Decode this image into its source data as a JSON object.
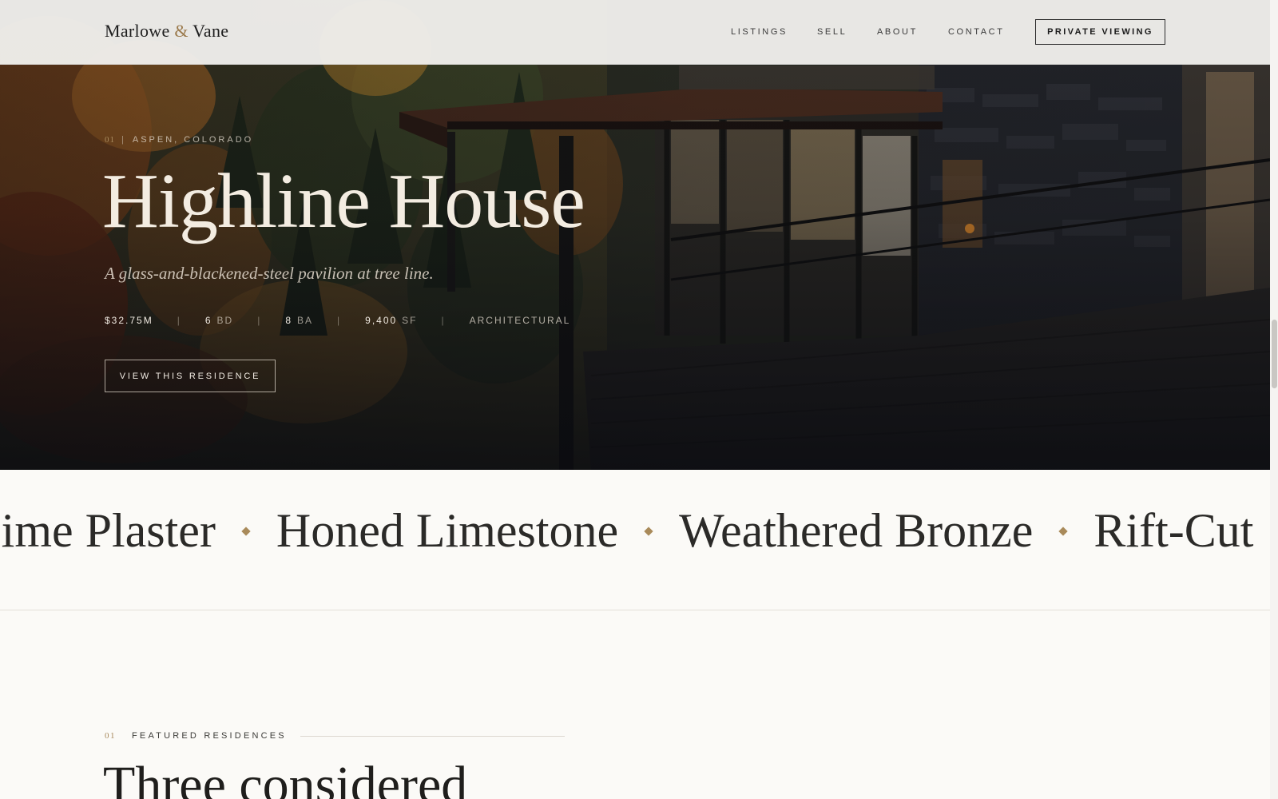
{
  "header": {
    "logo_left": "Marlowe",
    "logo_amp": "&",
    "logo_right": "Vane",
    "nav": [
      "LISTINGS",
      "SELL",
      "ABOUT",
      "CONTACT"
    ],
    "cta": "PRIVATE VIEWING"
  },
  "hero": {
    "index": "01",
    "location": "ASPEN, COLORADO",
    "title": "Highline House",
    "subtitle": "A glass-and-blackened-steel pavilion at tree line.",
    "price": "$32.75M",
    "beds_value": "6",
    "beds_unit": "BD",
    "baths_value": "8",
    "baths_unit": "BA",
    "area_value": "9,400",
    "area_unit": "SF",
    "style": "ARCHITECTURAL",
    "button": "VIEW THIS RESIDENCE"
  },
  "marquee": {
    "items": [
      "Lime Plaster",
      "Honed Limestone",
      "Weathered Bronze",
      "Rift-Cut"
    ]
  },
  "featured": {
    "index": "01",
    "label": "FEATURED RESIDENCES",
    "title": "Three considered"
  },
  "colors": {
    "accent_gold": "#a98a5a",
    "page_background": "#fbfaf7",
    "hero_text": "#f3ece1"
  }
}
